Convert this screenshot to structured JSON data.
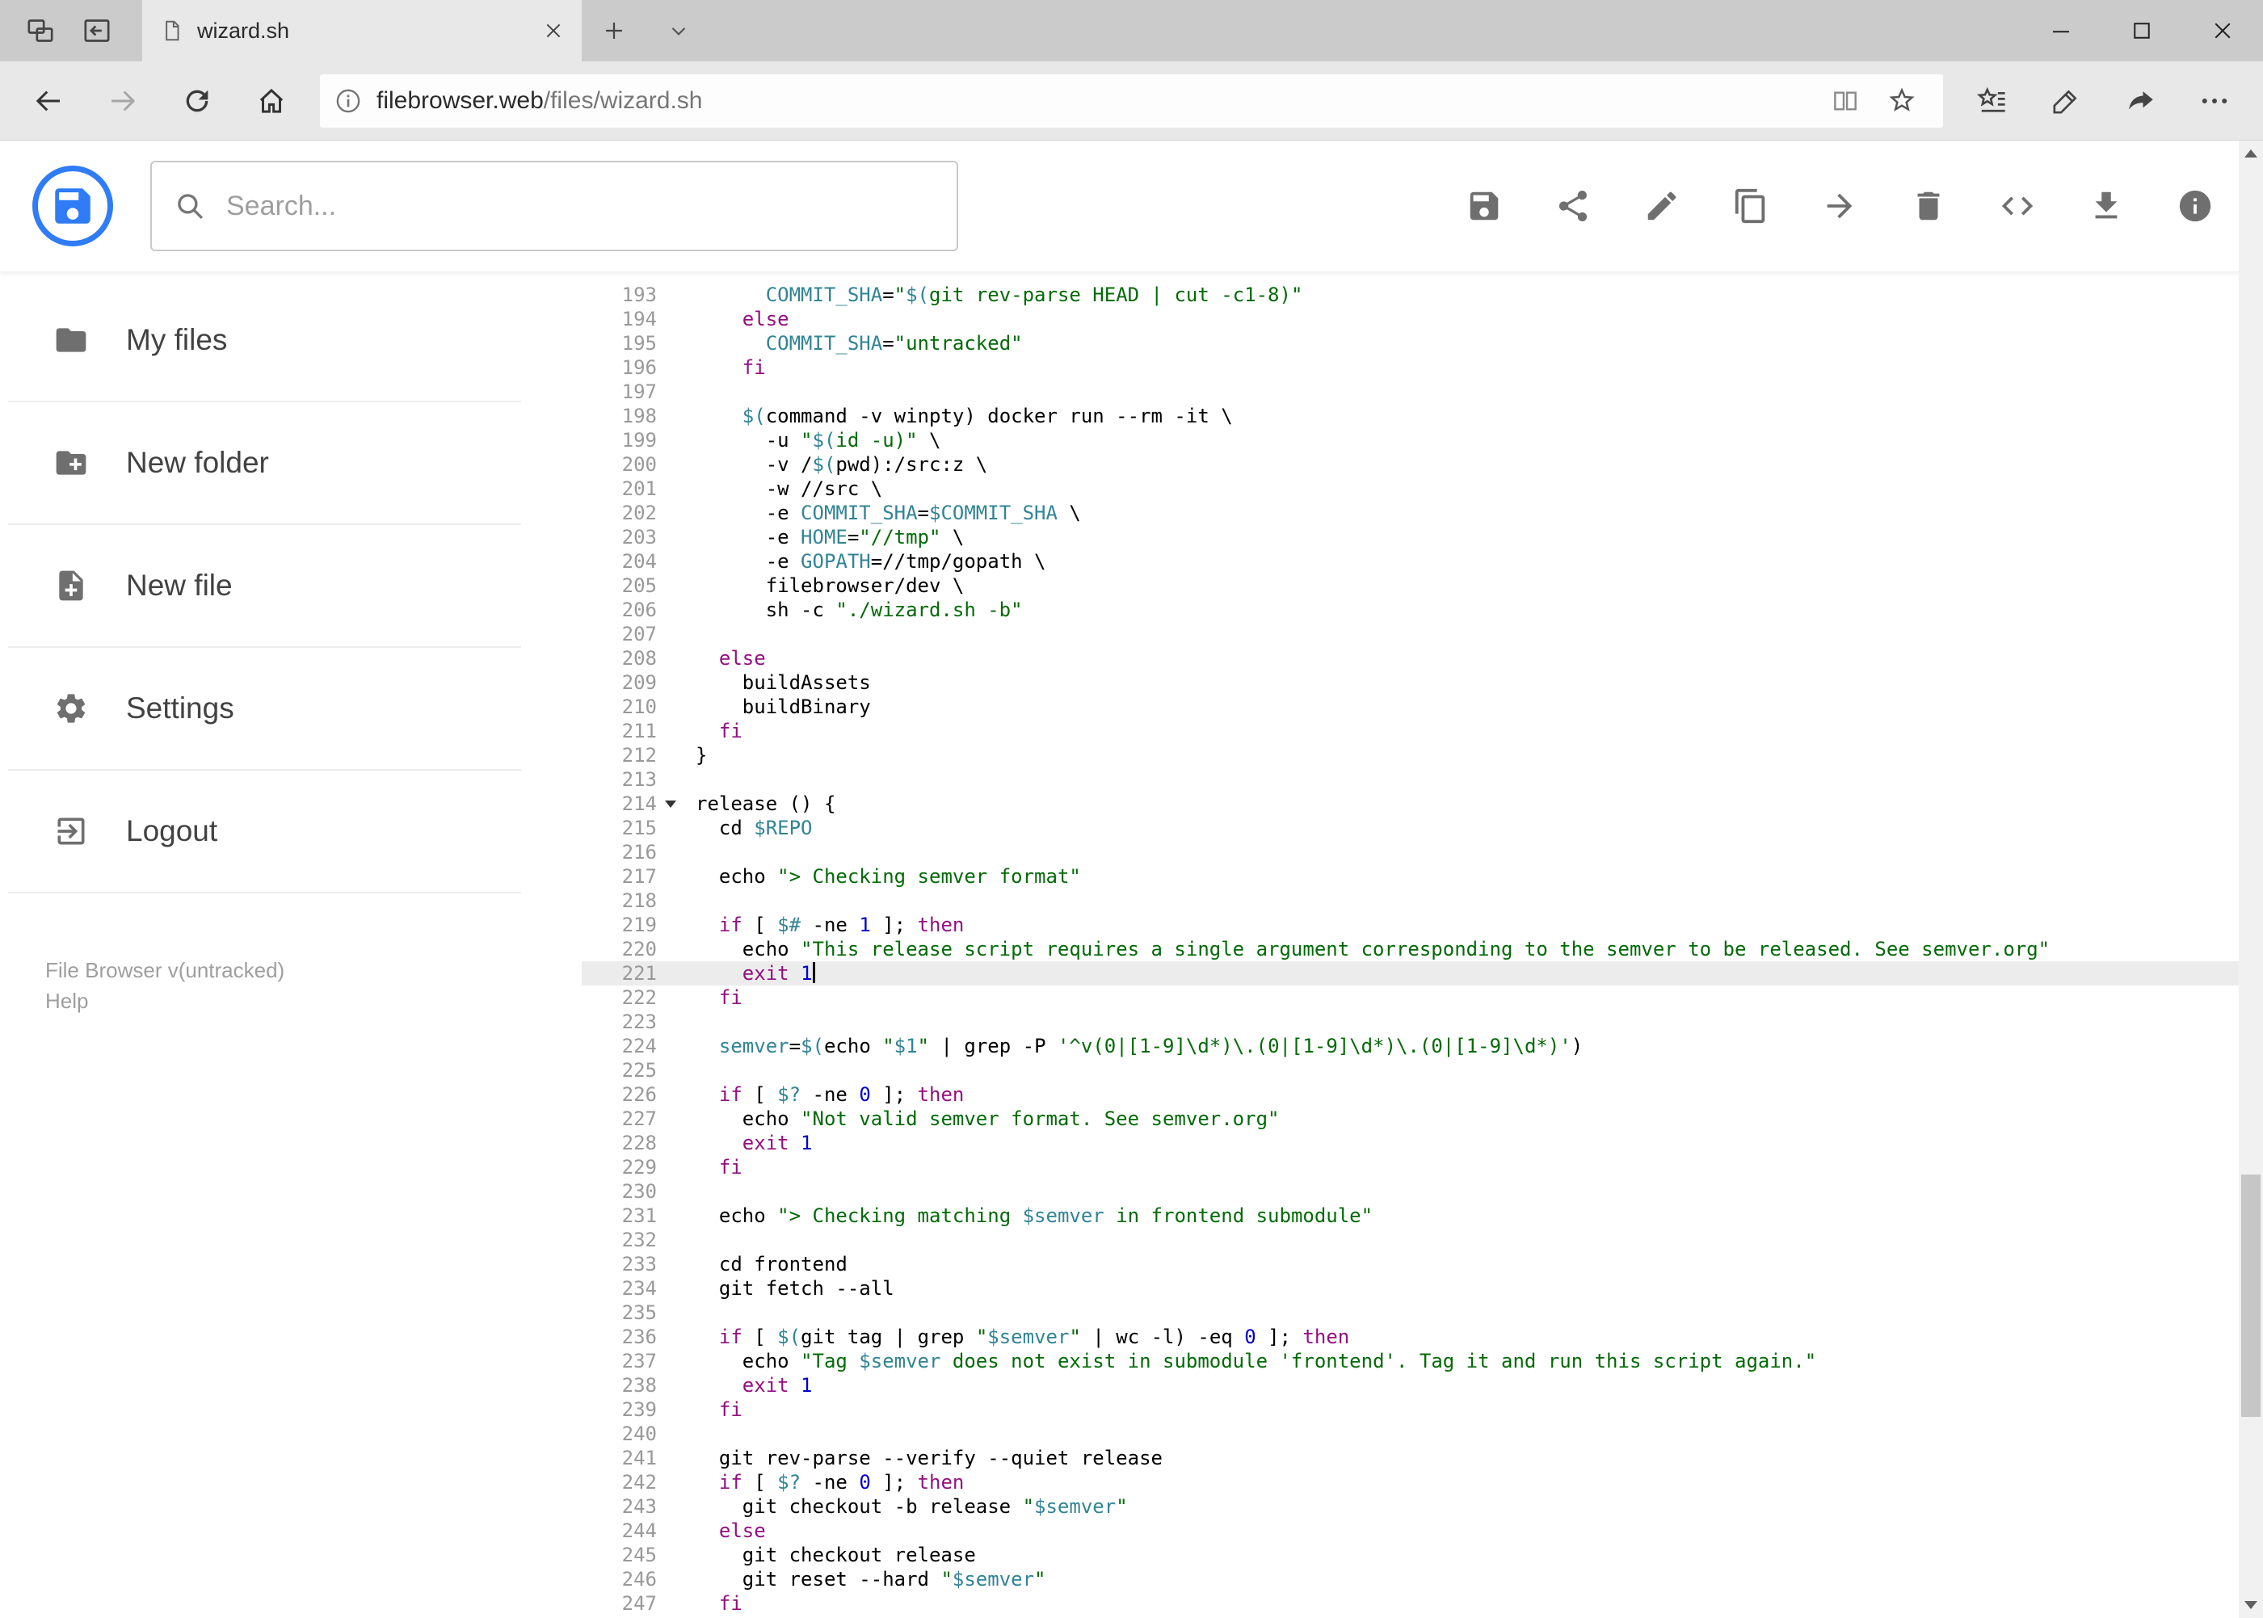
{
  "browser": {
    "tab": {
      "title": "wizard.sh"
    },
    "url": {
      "host": "filebrowser.web",
      "path": "/files/wizard.sh"
    },
    "tab_action_icons": [
      "tabs-preview",
      "set-tabs-aside"
    ],
    "nav_icons": [
      "back",
      "forward-disabled",
      "refresh",
      "home"
    ],
    "url_icons": [
      "info",
      "reading-view",
      "favorite-star"
    ],
    "action_icons": [
      "favorites-hub",
      "web-note-pen",
      "share",
      "more"
    ],
    "window_icons": [
      "minimize",
      "maximize",
      "close"
    ]
  },
  "header": {
    "search_placeholder": "Search...",
    "toolbar_icons": [
      "save",
      "share",
      "edit",
      "copy",
      "move",
      "delete",
      "code",
      "download",
      "info"
    ]
  },
  "sidebar": {
    "items": [
      {
        "label": "My files",
        "icon": "folder"
      },
      {
        "label": "New folder",
        "icon": "create-new-folder"
      },
      {
        "label": "New file",
        "icon": "note-add"
      },
      {
        "label": "Settings",
        "icon": "gear"
      },
      {
        "label": "Logout",
        "icon": "logout"
      }
    ],
    "footer": {
      "version": "File Browser v(untracked)",
      "help": "Help"
    }
  },
  "editor": {
    "first_line": 193,
    "active_line": 221,
    "cursor_line": 221,
    "fold_lines": [
      214
    ],
    "colors": {
      "keyword": "#930f80",
      "string": "#036a07",
      "variable": "#318495",
      "number": "#0000cd",
      "plain": "#000000",
      "line_number": "#999999",
      "active_line_bg": "#ececec"
    },
    "lines": [
      "      COMMIT_SHA=\"$(git rev-parse HEAD | cut -c1-8)\"",
      "    else",
      "      COMMIT_SHA=\"untracked\"",
      "    fi",
      "",
      "    $(command -v winpty) docker run --rm -it \\",
      "      -u \"$(id -u)\" \\",
      "      -v /$(pwd):/src:z \\",
      "      -w //src \\",
      "      -e COMMIT_SHA=$COMMIT_SHA \\",
      "      -e HOME=\"//tmp\" \\",
      "      -e GOPATH=//tmp/gopath \\",
      "      filebrowser/dev \\",
      "      sh -c \"./wizard.sh -b\"",
      "",
      "  else",
      "    buildAssets",
      "    buildBinary",
      "  fi",
      "}",
      "",
      "release () {",
      "  cd $REPO",
      "",
      "  echo \"> Checking semver format\"",
      "",
      "  if [ $# -ne 1 ]; then",
      "    echo \"This release script requires a single argument corresponding to the semver to be released. See semver.org\"",
      "    exit 1",
      "  fi",
      "",
      "  semver=$(echo \"$1\" | grep -P '^v(0|[1-9]\\d*)\\.(0|[1-9]\\d*)\\.(0|[1-9]\\d*)')",
      "",
      "  if [ $? -ne 0 ]; then",
      "    echo \"Not valid semver format. See semver.org\"",
      "    exit 1",
      "  fi",
      "",
      "  echo \"> Checking matching $semver in frontend submodule\"",
      "",
      "  cd frontend",
      "  git fetch --all",
      "",
      "  if [ $(git tag | grep \"$semver\" | wc -l) -eq 0 ]; then",
      "    echo \"Tag $semver does not exist in submodule 'frontend'. Tag it and run this script again.\"",
      "    exit 1",
      "  fi",
      "",
      "  git rev-parse --verify --quiet release",
      "  if [ $? -ne 0 ]; then",
      "    git checkout -b release \"$semver\"",
      "  else",
      "    git checkout release",
      "    git reset --hard \"$semver\"",
      "  fi"
    ]
  }
}
